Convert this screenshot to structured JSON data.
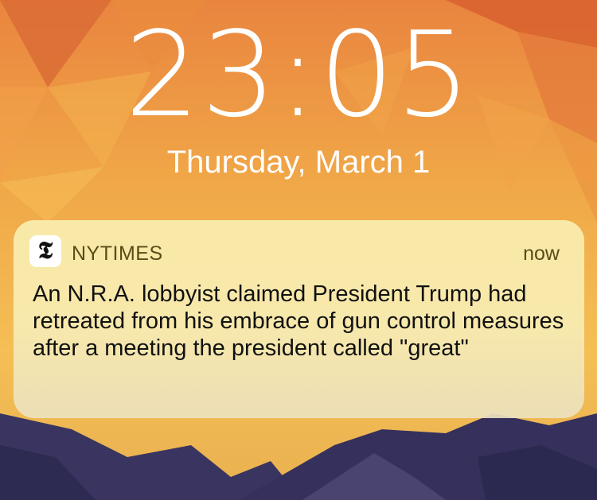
{
  "lockscreen": {
    "time": "23:05",
    "date": "Thursday, March 1"
  },
  "notification": {
    "app_icon": "nytimes-t-icon",
    "app_icon_glyph": "𝕿",
    "app_name": "NYTIMES",
    "time_ago": "now",
    "message": "An N.R.A. lobbyist claimed President Trump had retreated from his embrace of gun control measures after a meeting the president called \"great\""
  }
}
